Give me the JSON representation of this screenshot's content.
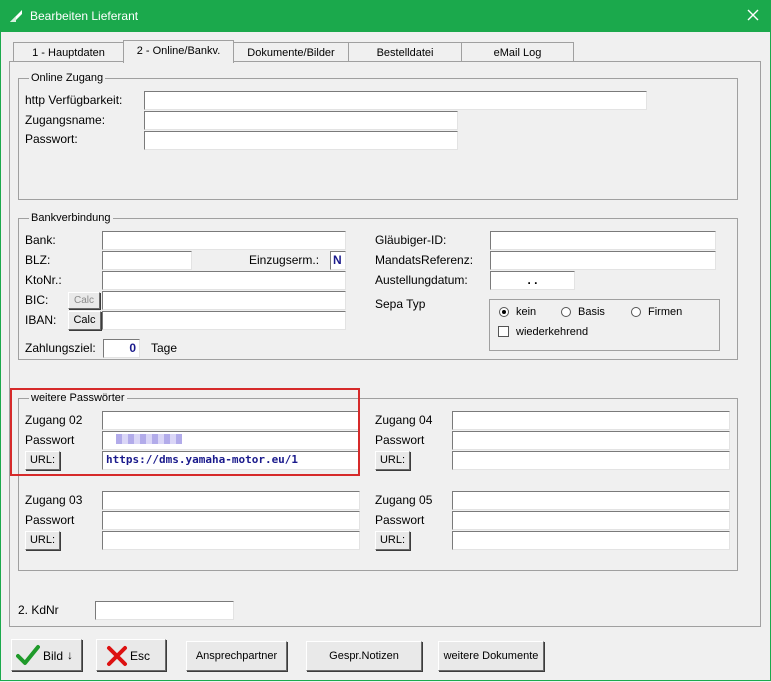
{
  "window": {
    "title": "Bearbeiten Lieferant"
  },
  "tabs": [
    {
      "label": "1 - Hauptdaten"
    },
    {
      "label": "2 - Online/Bankv."
    },
    {
      "label": "Dokumente/Bilder"
    },
    {
      "label": "Bestelldatei"
    },
    {
      "label": "eMail Log"
    }
  ],
  "online_zugang": {
    "legend": "Online Zugang",
    "http_label": "http Verfügbarkeit:",
    "http_value": "",
    "zugangsname_label": "Zugangsname:",
    "zugangsname_value": "",
    "passwort_label": "Passwort:",
    "passwort_value": ""
  },
  "bank": {
    "legend": "Bankverbindung",
    "bank_label": "Bank:",
    "blz_label": "BLZ:",
    "einzug_label": "Einzugserm.:",
    "einzug_value": "N",
    "ktonr_label": "KtoNr.:",
    "bic_label": "BIC:",
    "iban_label": "IBAN:",
    "calc_label": "Calc",
    "zahlungsziel_label": "Zahlungsziel:",
    "zahlungsziel_value": "0",
    "tage_label": "Tage",
    "glaeubiger_label": "Gläubiger-ID:",
    "mandat_label": "MandatsReferenz:",
    "austellung_label": "Austellungdatum:",
    "austellung_value": ".   .",
    "sepa_label": "Sepa Typ",
    "sepa_options": [
      "kein",
      "Basis",
      "Firmen"
    ],
    "sepa_selected": "kein",
    "wiederkehrend_label": "wiederkehrend"
  },
  "passwords": {
    "legend": "weitere Passwörter",
    "url_button": "URL:",
    "passwort_label": "Passwort",
    "z02_label": "Zugang 02",
    "z02_url": "https://dms.yamaha-motor.eu/1",
    "z03_label": "Zugang 03",
    "z04_label": "Zugang 04",
    "z05_label": "Zugang 05"
  },
  "kdnr": {
    "label": "2. KdNr",
    "value": ""
  },
  "footer": {
    "bild_label": "Bild",
    "esc_label": "Esc",
    "ansprech_label": "Ansprechpartner",
    "notizen_label": "Gespr.Notizen",
    "dokumente_label": "weitere Dokumente"
  }
}
